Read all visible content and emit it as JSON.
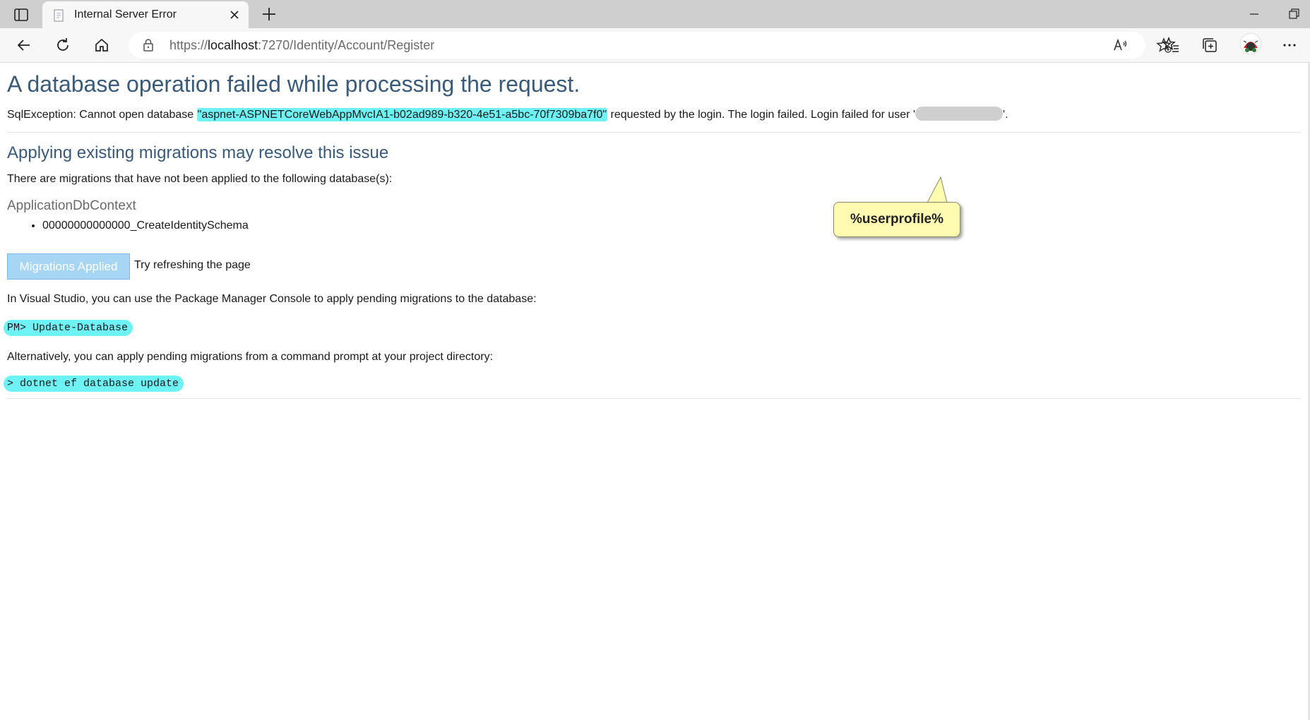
{
  "browser": {
    "tab_title": "Internal Server Error",
    "url_prefix": "https://",
    "url_host": "localhost",
    "url_rest": ":7270/Identity/Account/Register"
  },
  "page": {
    "heading": "A database operation failed while processing the request.",
    "sql_prefix": "SqlException: Cannot open database ",
    "database_name": "\"aspnet-ASPNETCoreWebAppMvcIA1-b02ad989-b320-4e51-a5bc-70f7309ba7f0\"",
    "sql_suffix": " requested by the login. The login failed. Login failed for user '",
    "sql_end": "'.",
    "subheading": "Applying existing migrations may resolve this issue",
    "pending_text": "There are migrations that have not been applied to the following database(s):",
    "context_name": "ApplicationDbContext",
    "migrations": [
      "00000000000000_CreateIdentitySchema"
    ],
    "applied_button": "Migrations Applied",
    "retry_text": "Try refreshing the page",
    "vs_text": "In Visual Studio, you can use the Package Manager Console to apply pending migrations to the database:",
    "pm_command": "PM> Update-Database",
    "cli_text": "Alternatively, you can apply pending migrations from a command prompt at your project directory:",
    "cli_command": "> dotnet ef database update"
  },
  "annotation": {
    "callout_text": "%userprofile%"
  },
  "colors": {
    "highlight": "#6ff2f4",
    "heading": "#3a5a7a",
    "callout": "#fffbb0",
    "applied_button": "#a7d6f4"
  },
  "icons": [
    "tab-strip-icon",
    "page-favicon",
    "tab-close-icon",
    "new-tab-icon",
    "minimize-icon",
    "restore-icon",
    "back-icon",
    "refresh-icon",
    "home-icon",
    "lock-icon",
    "read-aloud-icon",
    "add-favorite-icon",
    "favorites-icon",
    "collections-icon",
    "profile-avatar",
    "more-icon"
  ]
}
